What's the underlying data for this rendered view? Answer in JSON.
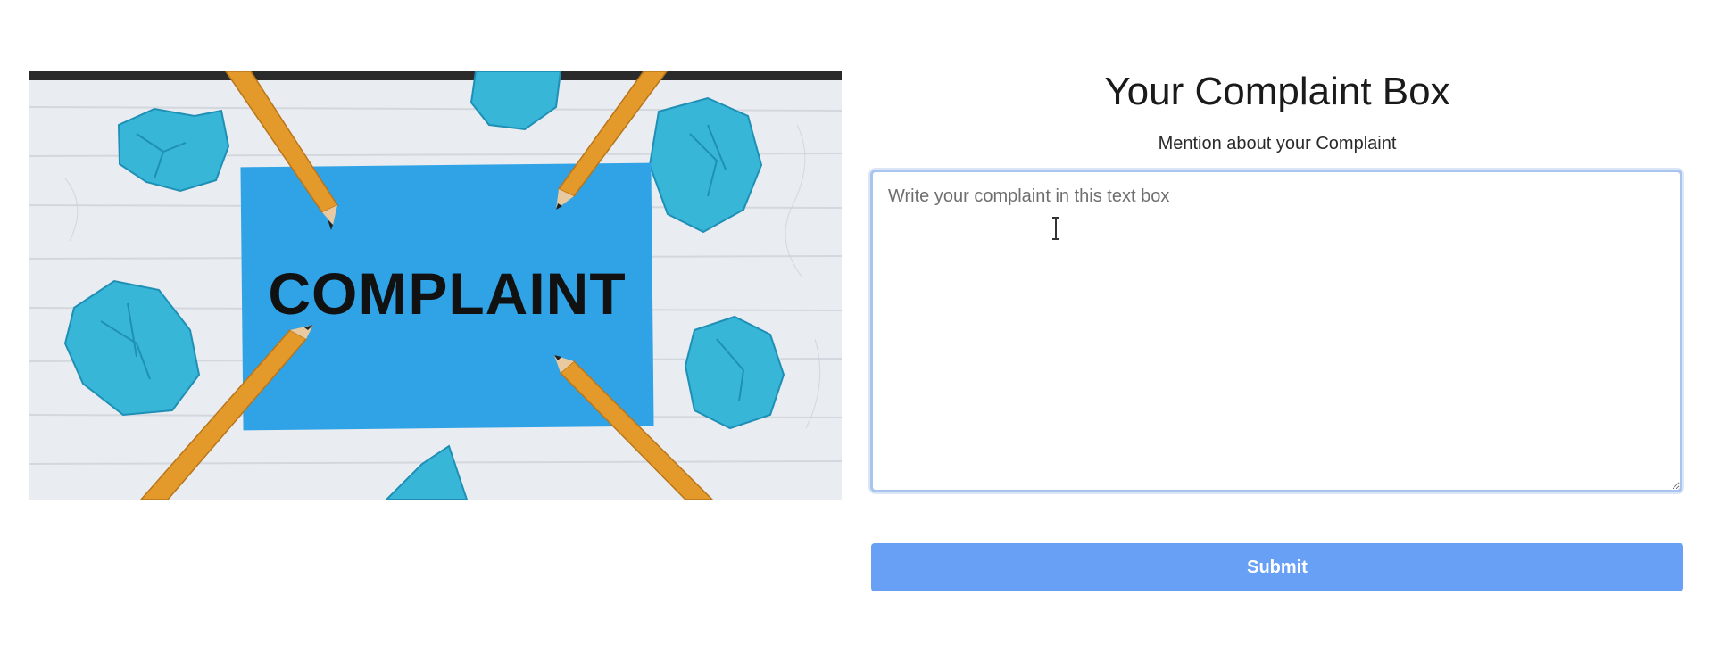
{
  "hero": {
    "image_text": "COMPLAINT",
    "colors": {
      "card": "#2fa3e6",
      "paper": "#37b6d8",
      "pencil": "#e39a2a",
      "wood_background": "#e9ecf0"
    }
  },
  "form": {
    "title": "Your Complaint Box",
    "subtitle": "Mention about your Complaint",
    "textarea_placeholder": "Write your complaint in this text box",
    "textarea_value": "",
    "submit_label": "Submit"
  },
  "colors": {
    "submit_button": "#68a0f5",
    "textarea_focus_border": "#a9c5ef"
  }
}
